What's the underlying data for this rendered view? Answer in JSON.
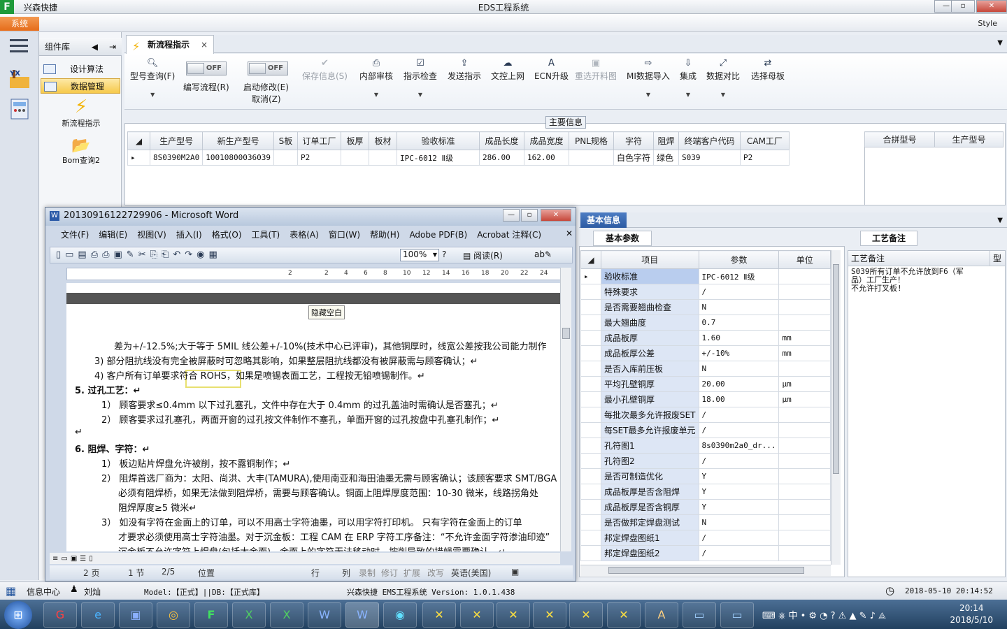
{
  "app": {
    "name": "兴森快捷",
    "title": "EDS工程系统",
    "system_button": "系统",
    "style_label": "Style"
  },
  "component_panel": {
    "title": "组件库",
    "items": [
      {
        "label": "设计算法"
      },
      {
        "label": "数据管理"
      }
    ],
    "big_items": [
      {
        "label": "新流程指示"
      },
      {
        "label": "Bom查询2"
      }
    ]
  },
  "tab": {
    "label": "新流程指示"
  },
  "toolbar": {
    "query": "型号查询(F)",
    "write_flow": "编写流程(R)",
    "toggle_off": "OFF",
    "start_modify": "启动修改(E)",
    "cancel": "取消(Z)",
    "save_info": "保存信息(S)",
    "internal_review": "内部审核",
    "instruction_check": "指示检查",
    "send_instruction": "发送指示",
    "doc_upload": "文控上网",
    "ecn_upgrade": "ECN升级",
    "reselect_cut": "重选开料图",
    "mi_import": "MI数据导入",
    "integrate": "集成",
    "data_compare": "数据对比",
    "select_mother": "选择母板"
  },
  "main_info": {
    "legend": "主要信息",
    "columns": [
      "生产型号",
      "新生产型号",
      "S板",
      "订单工厂",
      "板厚",
      "板材",
      "验收标准",
      "成品长度",
      "成品宽度",
      "PNL规格",
      "字符",
      "阻焊",
      "终端客户代码",
      "CAM工厂"
    ],
    "row": [
      "8S0390M2A0",
      "10010800036039",
      "",
      "P2",
      "",
      "",
      "IPC-6012 Ⅱ级",
      "286.00",
      "162.00",
      "",
      "白色字符",
      "绿色",
      "S039",
      "P2"
    ],
    "side_columns": [
      "合拼型号",
      "生产型号"
    ]
  },
  "basic_info": {
    "tab": "基本信息",
    "sub_tab": "基本参数",
    "notes_tab": "工艺备注",
    "columns": [
      "项目",
      "参数",
      "单位"
    ],
    "rows": [
      {
        "item": "验收标准",
        "value": "IPC-6012 Ⅱ级",
        "unit": ""
      },
      {
        "item": "特殊要求",
        "value": "/",
        "unit": ""
      },
      {
        "item": "是否需要翘曲检查",
        "value": "N",
        "unit": ""
      },
      {
        "item": "最大翘曲度",
        "value": "0.7",
        "unit": ""
      },
      {
        "item": "成品板厚",
        "value": "1.60",
        "unit": "mm"
      },
      {
        "item": "成品板厚公差",
        "value": "+/-10%",
        "unit": "mm"
      },
      {
        "item": "是否入库前压板",
        "value": "N",
        "unit": ""
      },
      {
        "item": "平均孔壁铜厚",
        "value": "20.00",
        "unit": "μm"
      },
      {
        "item": "最小孔壁铜厚",
        "value": "18.00",
        "unit": "μm"
      },
      {
        "item": "每批次最多允许报废SET",
        "value": "/",
        "unit": ""
      },
      {
        "item": "每SET最多允许报废单元",
        "value": "/",
        "unit": ""
      },
      {
        "item": "孔符图1",
        "value": "8s0390m2a0_dr...",
        "unit": ""
      },
      {
        "item": "孔符图2",
        "value": "/",
        "unit": ""
      },
      {
        "item": "是否可制造优化",
        "value": "Y",
        "unit": ""
      },
      {
        "item": "成品板厚是否含阻焊",
        "value": "Y",
        "unit": ""
      },
      {
        "item": "成品板厚是否含铜厚",
        "value": "Y",
        "unit": ""
      },
      {
        "item": "是否做邦定焊盘测试",
        "value": "N",
        "unit": ""
      },
      {
        "item": "邦定焊盘图纸1",
        "value": "/",
        "unit": ""
      },
      {
        "item": "邦定焊盘图纸2",
        "value": "/",
        "unit": ""
      }
    ],
    "notes_header": "工艺备注",
    "notes_col2": "型",
    "notes_text_1": "S039所有订单不允许放到F6（军",
    "notes_text_2": "品）工厂生产！",
    "notes_text_3": "不允许打叉板!"
  },
  "word": {
    "title": "20130916122729906 - Microsoft Word",
    "menu": [
      "文件(F)",
      "编辑(E)",
      "视图(V)",
      "插入(I)",
      "格式(O)",
      "工具(T)",
      "表格(A)",
      "窗口(W)",
      "帮助(H)",
      "Adobe PDF(B)",
      "Acrobat 注释(C)"
    ],
    "zoom": "100%",
    "read_mode": "阅读(R)",
    "hide_blank": "隐藏空白",
    "ruler": [
      "2",
      "2",
      "4",
      "6",
      "8",
      "10",
      "12",
      "14",
      "16",
      "18",
      "20",
      "22",
      "24"
    ],
    "lines": [
      "差为+/-12.5%;大于等于 5MIL 线公差+/-10%(技术中心已评审)，其他铜厚时，线宽公差按我公司能力制作",
      "3) 部分阻抗线没有完全被屏蔽时可忽略其影响，如果整层阻抗线都没有被屏蔽需与顾客确认；↵",
      "4) 客户所有订单要求符合 ROHS，如果是喷锡表面工艺，工程按无铅喷锡制作。↵",
      "5.   过孔工艺：↵",
      "1） 顾客要求≤0.4mm 以下过孔塞孔，文件中存在大于 0.4mm 的过孔盖油时需确认是否塞孔；↵",
      "2） 顾客要求过孔塞孔，两面开窗的过孔按文件制作不塞孔，单面开窗的过孔按盘中孔塞孔制作；↵",
      "↵",
      "6.   阻焊、字符：↵",
      "1） 板边贴片焊盘允许被削，按不露铜制作；↵",
      "2） 阻焊首选厂商为：太阳、尚洪、大丰(TAMURA),使用南亚和海田油墨无需与顾客确认；该顾客要求 SMT/BGA",
      "必须有阻焊桥，如果无法做到阻焊桥，需要与顾客确认。铜面上阻焊厚度范围：10-30 微米，线路拐角处",
      "阻焊厚度≥5 微米↵",
      "3） 如没有字符在金面上的订单，可以不用高士字符油墨，可以用字符打印机。  只有字符在金面上的订单",
      "才要求必须使用高士字符油墨。对于沉金板：工程 CAM 在 ERP 字符工序备注：“不允许金面字符渗油印迹”",
      "沉金板不允许字符上焊盘(包括大金面)，金面上的字符无法移动时，按削导致的措蝇需要确认，↵"
    ],
    "status": {
      "page": "2 页",
      "section": "1 节",
      "pages": "2/5",
      "position": "位置",
      "row": "行",
      "col": "列",
      "rec": "录制",
      "rev": "修订",
      "ext": "扩展",
      "ovr": "改写",
      "lang": "英语(美国)"
    }
  },
  "statusbar": {
    "info_center": "信息中心",
    "user": "刘灿",
    "model": "Model:【正式】||DB:【正式库】",
    "version": "兴森快捷  EMS工程系统  Version: 1.0.1.438",
    "datetime": "2018-05-10 20:14:52"
  },
  "taskbar": {
    "ime": "中",
    "time": "20:14",
    "date": "2018/5/10"
  },
  "colors": {
    "accent": "#2d5ba3",
    "system_button": "#e56c1a",
    "selection": "#f6c94b"
  }
}
